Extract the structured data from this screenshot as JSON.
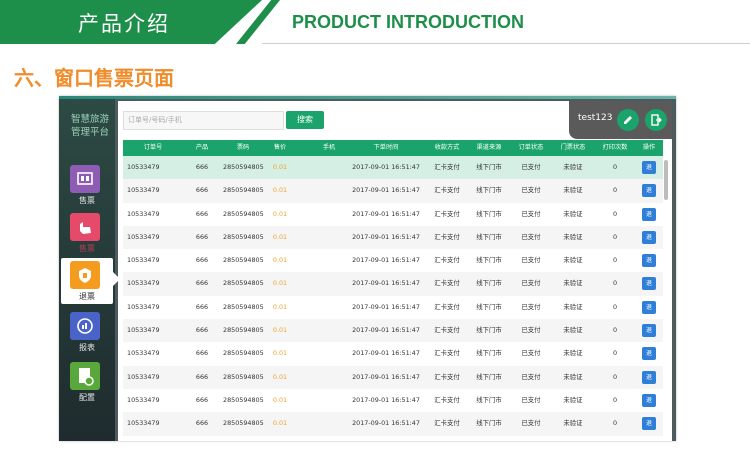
{
  "banner": {
    "title_cn": "产品介绍",
    "title_en": "PRODUCT INTRODUCTION"
  },
  "section_title": "六、窗口售票页面",
  "app": {
    "title_line1": "智慧旅游",
    "title_line2": "管理平台",
    "nav": [
      {
        "label": "售票",
        "icon": "ticket-icon",
        "color": "#8e5bb5",
        "active": false
      },
      {
        "label": "售票",
        "icon": "hand-icon",
        "color": "#e64a6a",
        "active": false
      },
      {
        "label": "退票",
        "icon": "refund-icon",
        "color": "#f39c1f",
        "active": true
      },
      {
        "label": "报表",
        "icon": "chart-icon",
        "color": "#4a63c9",
        "active": false
      },
      {
        "label": "配置",
        "icon": "settings-doc-icon",
        "color": "#5aa83c",
        "active": false
      }
    ],
    "search": {
      "placeholder": "订单号/号码/手机",
      "button": "搜索"
    },
    "user": {
      "name": "test123"
    },
    "table": {
      "columns": [
        "订单号",
        "产品",
        "票码",
        "售价",
        "手机",
        "下单时间",
        "收款方式",
        "渠道来源",
        "订单状态",
        "门票状态",
        "打印次数",
        "操作"
      ],
      "rows": [
        [
          "10533479",
          "666",
          "2850594805",
          "0.01",
          "",
          "2017-09-01 16:51:47",
          "汇卡支付",
          "线下门市",
          "已支付",
          "未验证",
          "0",
          "退"
        ],
        [
          "10533479",
          "666",
          "2850594805",
          "0.01",
          "",
          "2017-09-01 16:51:47",
          "汇卡支付",
          "线下门市",
          "已支付",
          "未验证",
          "0",
          "退"
        ],
        [
          "10533479",
          "666",
          "2850594805",
          "0.01",
          "",
          "2017-09-01 16:51:47",
          "汇卡支付",
          "线下门市",
          "已支付",
          "未验证",
          "0",
          "退"
        ],
        [
          "10533479",
          "666",
          "2850594805",
          "0.01",
          "",
          "2017-09-01 16:51:47",
          "汇卡支付",
          "线下门市",
          "已支付",
          "未验证",
          "0",
          "退"
        ],
        [
          "10533479",
          "666",
          "2850594805",
          "0.01",
          "",
          "2017-09-01 16:51:47",
          "汇卡支付",
          "线下门市",
          "已支付",
          "未验证",
          "0",
          "退"
        ],
        [
          "10533479",
          "666",
          "2850594805",
          "0.01",
          "",
          "2017-09-01 16:51:47",
          "汇卡支付",
          "线下门市",
          "已支付",
          "未验证",
          "0",
          "退"
        ],
        [
          "10533479",
          "666",
          "2850594805",
          "0.01",
          "",
          "2017-09-01 16:51:47",
          "汇卡支付",
          "线下门市",
          "已支付",
          "未验证",
          "0",
          "退"
        ],
        [
          "10533479",
          "666",
          "2850594805",
          "0.01",
          "",
          "2017-09-01 16:51:47",
          "汇卡支付",
          "线下门市",
          "已支付",
          "未验证",
          "0",
          "退"
        ],
        [
          "10533479",
          "666",
          "2850594805",
          "0.01",
          "",
          "2017-09-01 16:51:47",
          "汇卡支付",
          "线下门市",
          "已支付",
          "未验证",
          "0",
          "退"
        ],
        [
          "10533479",
          "666",
          "2850594805",
          "0.01",
          "",
          "2017-09-01 16:51:47",
          "汇卡支付",
          "线下门市",
          "已支付",
          "未验证",
          "0",
          "退"
        ],
        [
          "10533479",
          "666",
          "2850594805",
          "0.01",
          "",
          "2017-09-01 16:51:47",
          "汇卡支付",
          "线下门市",
          "已支付",
          "未验证",
          "0",
          "退"
        ],
        [
          "10533479",
          "666",
          "2850594805",
          "0.01",
          "",
          "2017-09-01 16:51:47",
          "汇卡支付",
          "线下门市",
          "已支付",
          "未验证",
          "0",
          "退"
        ]
      ]
    }
  }
}
